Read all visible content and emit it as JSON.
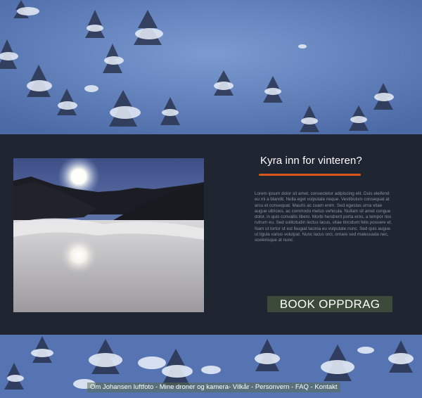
{
  "colors": {
    "panel_bg": "#1f2631",
    "accent_rule": "#d9561c",
    "button_bg": "#3c4a3a",
    "snow_sky": "#6b8ac3"
  },
  "hero": {
    "top_image": "aerial snowy forest",
    "bottom_image": "aerial snowy forest"
  },
  "feature": {
    "photo": "misty valley with sun and mountains",
    "heading": "Kyra inn for vinteren?",
    "body": "Lorem ipsum dolor sit amet, consectetur adipiscing elit. Duis eleifend eu mi a blandit. Nulla eget vulputate neque. Vestibulum consequat at arcu et consequat. Mauris ac cuam enim. Sed egestas urna vitae augue ultricies, ac commodo metus vehicula. Nullam sit amet congue dolor, in quis convallis libero. Morbi hendrerit porta eros, a tempor nisi rutrum eu. Sed sollicitudin lectus lacus, vitae tincidunt felis posuere et. Nam ut tortor ut est feugiat lacinia eu vulputate nunc. Sed quis augue ut ligula varius volutpat. Nunc lacus orci, ornare sed malesuada nec, scelerisque at nunc.",
    "button_label": "BOOK OPPDRAG"
  },
  "footer": {
    "links": [
      "Om Johansen luftfoto",
      "Mine droner og kamera",
      "Vilkår",
      "Personvern",
      "FAQ",
      "Kontakt"
    ],
    "sep_0": " - ",
    "sep_1": "- ",
    "sep_2": " - ",
    "sep_3": " - ",
    "sep_4": " - "
  }
}
